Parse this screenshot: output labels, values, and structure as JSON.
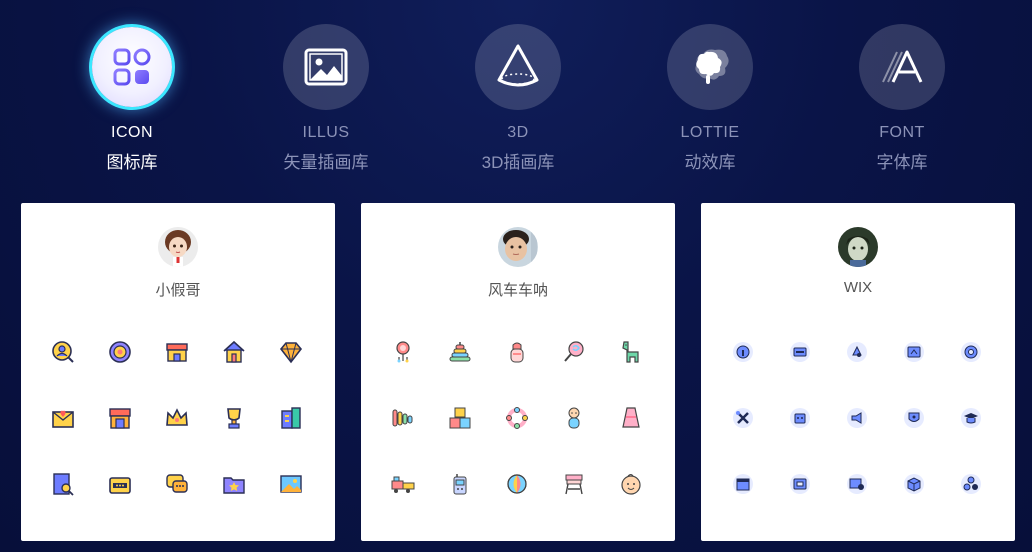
{
  "tabs": [
    {
      "id": "icon",
      "en": "ICON",
      "zh": "图标库",
      "active": true,
      "icon": "grid-apps-icon"
    },
    {
      "id": "illus",
      "en": "ILLUS",
      "zh": "矢量插画库",
      "active": false,
      "icon": "image-icon"
    },
    {
      "id": "3d",
      "en": "3D",
      "zh": "3D插画库",
      "active": false,
      "icon": "cone-icon"
    },
    {
      "id": "lottie",
      "en": "LOTTIE",
      "zh": "动效库",
      "active": false,
      "icon": "splash-icon"
    },
    {
      "id": "font",
      "en": "FONT",
      "zh": "字体库",
      "active": false,
      "icon": "font-a-icon"
    }
  ],
  "cards": [
    {
      "author": "小假哥",
      "avatar": "cartoon-girl-avatar",
      "icons": [
        "user-search-icon",
        "target-badge-icon",
        "storefront-icon",
        "house-icon",
        "diamond-icon",
        "love-letter-icon",
        "shop-icon",
        "crown-icon",
        "trophy-icon",
        "building-icon",
        "document-search-icon",
        "wallet-icon",
        "chat-bubbles-icon",
        "folder-star-icon",
        "picture-icon"
      ]
    },
    {
      "author": "风车车呐",
      "avatar": "child-photo-avatar",
      "icons": [
        "rattle-icon",
        "stacking-rings-icon",
        "baby-bottle-icon",
        "lollipop-icon",
        "llama-icon",
        "xylophone-icon",
        "toy-blocks-icon",
        "teether-ring-icon",
        "baby-icon",
        "baby-dress-icon",
        "toy-train-icon",
        "walkie-talkie-icon",
        "beach-ball-icon",
        "high-chair-icon",
        "baby-face-icon"
      ]
    },
    {
      "author": "WIX",
      "avatar": "illustrated-avatar",
      "icons": [
        "info-badge-icon",
        "ticket-badge-icon",
        "recycle-badge-icon",
        "scale-badge-icon",
        "ring-badge-icon",
        "tools-badge-icon",
        "robot-badge-icon",
        "megaphone-badge-icon",
        "shield-badge-icon",
        "graduation-badge-icon",
        "window-badge-icon",
        "card-badge-icon",
        "device-badge-icon",
        "box-badge-icon",
        "cubes-badge-icon"
      ]
    }
  ]
}
